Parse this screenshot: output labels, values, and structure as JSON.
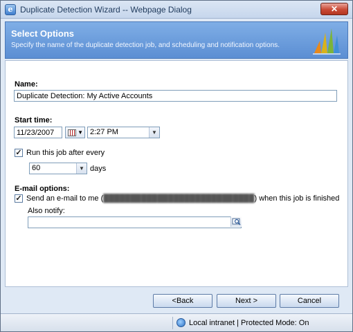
{
  "window": {
    "title": "Duplicate Detection Wizard -- Webpage Dialog",
    "close_glyph": "✕"
  },
  "header": {
    "title": "Select Options",
    "subtitle": "Specify the name of the duplicate detection job, and scheduling and notification options."
  },
  "form": {
    "name_label": "Name:",
    "name_value": "Duplicate Detection: My Active Accounts",
    "start_time_label": "Start time:",
    "start_date_value": "11/23/2007",
    "start_time_value": "2:27 PM",
    "recurrence": {
      "checked": true,
      "check_glyph": "✓",
      "label": "Run this job after every",
      "interval_value": "60",
      "interval_unit": "days"
    },
    "email": {
      "section_label": "E-mail options:",
      "check_glyph": "✓",
      "send_label_before": "Send an e-mail to me (",
      "redacted_address": "████████████████████████████",
      "send_label_after": ") when this job is finished",
      "also_notify_label": "Also notify:",
      "also_notify_value": ""
    }
  },
  "footer": {
    "back_label": "<Back",
    "next_label": "Next >",
    "cancel_label": "Cancel"
  },
  "status": {
    "zone_text": "Local intranet | Protected Mode: On"
  },
  "colors": {
    "header_bg": "#6a9ddd",
    "dialog_bg": "#dfe9f5",
    "close_red": "#c94a36"
  },
  "icons": [
    "ie-app-icon",
    "close-icon",
    "dynamics-logo",
    "calendar-icon",
    "chevron-down-icon",
    "lookup-icon",
    "globe-icon"
  ]
}
